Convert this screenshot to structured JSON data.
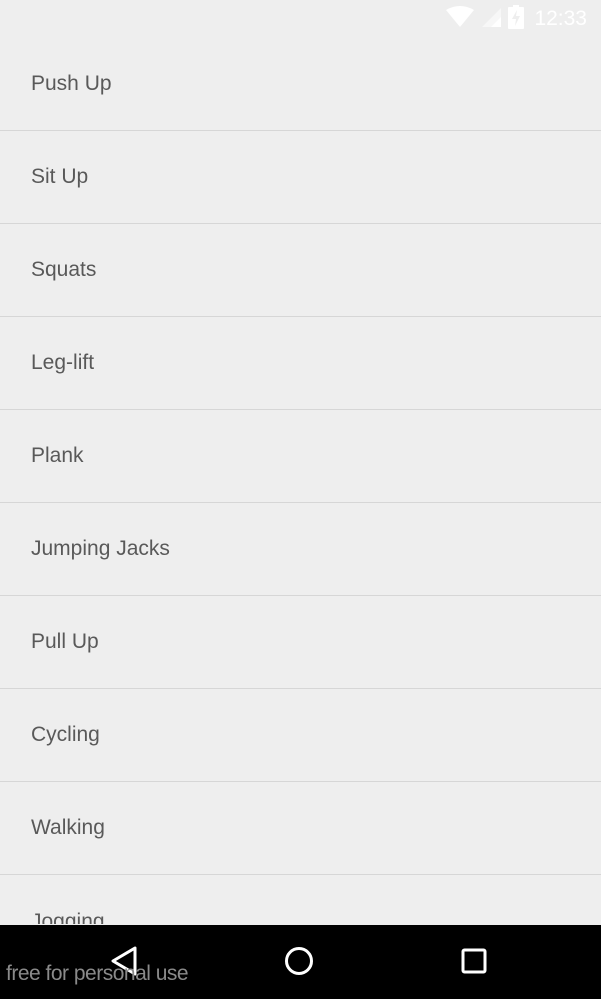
{
  "status_bar": {
    "time": "12:33",
    "icons": [
      "wifi-icon",
      "signal-icon",
      "battery-charging-icon"
    ]
  },
  "exercise_list": {
    "items": [
      {
        "label": "Push Up"
      },
      {
        "label": "Sit Up"
      },
      {
        "label": "Squats"
      },
      {
        "label": "Leg-lift"
      },
      {
        "label": "Plank"
      },
      {
        "label": "Jumping Jacks"
      },
      {
        "label": "Pull Up"
      },
      {
        "label": "Cycling"
      },
      {
        "label": "Walking"
      },
      {
        "label": "Jogging"
      }
    ]
  },
  "nav_bar": {
    "icons": [
      "back-icon",
      "home-icon",
      "recents-icon"
    ]
  },
  "watermark": {
    "text": "free for personal use"
  },
  "colors": {
    "background": "#eeeeee",
    "text": "#595959",
    "divider": "#d6d6d6",
    "nav_bar": "#000000"
  }
}
